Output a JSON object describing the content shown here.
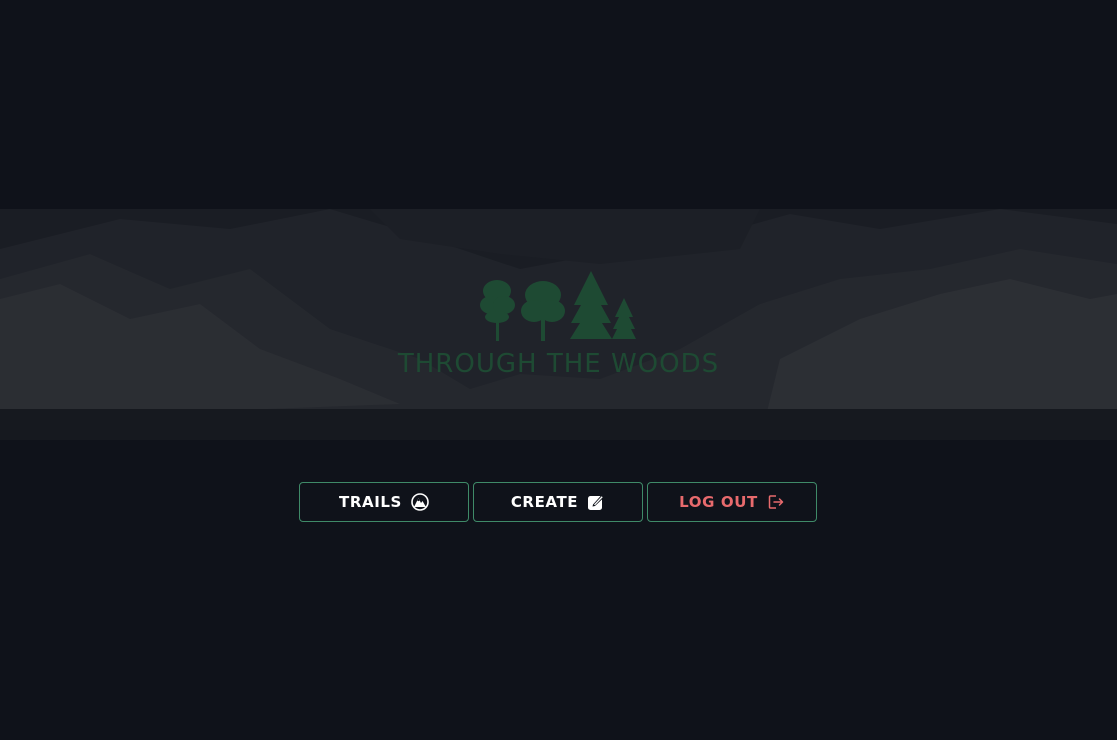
{
  "brand": {
    "title": "THROUGH THE WOODS",
    "logo_icon": "trees-icon",
    "title_color": "#1e4a33"
  },
  "nav": {
    "trails": {
      "label": "TRAILS",
      "icon": "mountain-globe-icon"
    },
    "create": {
      "label": "CREATE",
      "icon": "edit-square-icon"
    },
    "logout": {
      "label": "LOG OUT",
      "icon": "logout-arrow-icon",
      "color": "#e86a6d"
    }
  },
  "colors": {
    "background": "#0f121a",
    "button_border": "#3f8a68",
    "button_text": "#ffffff"
  }
}
